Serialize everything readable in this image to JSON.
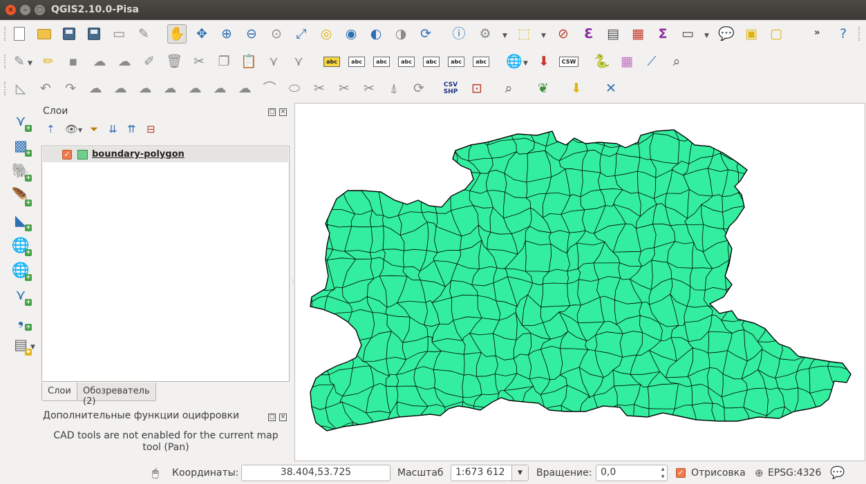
{
  "window": {
    "title": "QGIS2.10.0-Pisa",
    "close_glyph": "×",
    "min_glyph": "–",
    "max_glyph": "□"
  },
  "search": {
    "value": "",
    "clear_glyph": "⌫"
  },
  "layers_panel": {
    "title": "Слои",
    "layers": [
      {
        "name": "boundary-polygon",
        "visible": true,
        "fill_color": "#6fd08c"
      }
    ]
  },
  "tabs": {
    "layers": "Слои",
    "browser": "Обозреватель (2)"
  },
  "cad_panel": {
    "title": "Дополнительные функции оцифровки",
    "message": "CAD tools are not enabled for the current map tool (Pan)"
  },
  "map": {
    "fill_color": "#33ee9e",
    "stroke_color": "#000000"
  },
  "statusbar": {
    "coord_label": "Координаты:",
    "coord_value": "38.404,53.725",
    "scale_label": "Масштаб",
    "scale_value": "1:673 612",
    "rotation_label": "Вращение:",
    "rotation_value": "0,0",
    "render_label": "Отрисовка",
    "render_checked": true,
    "crs": "EPSG:4326"
  },
  "toolbar_icons": {
    "row1": [
      "new-project",
      "open-project",
      "save-project",
      "save-as",
      "new-print-composer",
      "composer-manager",
      "pan",
      "pan-to-selection",
      "zoom-in",
      "zoom-out",
      "zoom-native",
      "zoom-full",
      "zoom-to-selection",
      "zoom-to-layer",
      "zoom-last",
      "zoom-next",
      "refresh",
      "identify",
      "action",
      "select",
      "deselect",
      "field-calculator",
      "attribute-table",
      "statistics",
      "sum",
      "measure",
      "annotation",
      "new-bookmark",
      "show-bookmarks",
      "help"
    ],
    "label_abc": "abc",
    "csw_label": "CSW",
    "csv_label": "CSV SHP"
  }
}
